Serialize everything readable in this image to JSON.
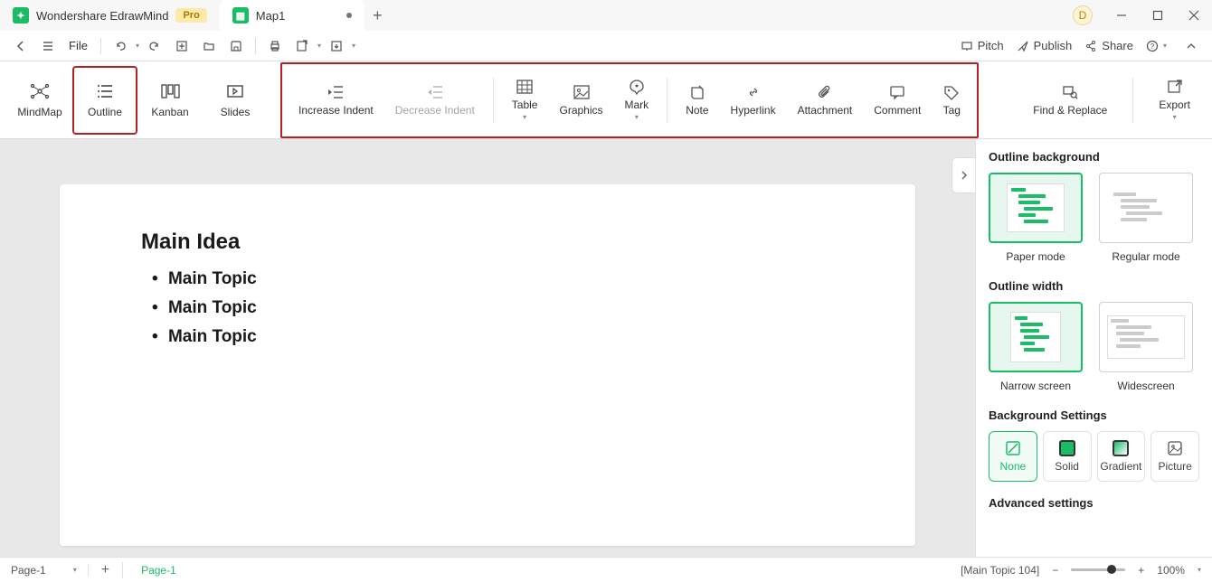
{
  "titlebar": {
    "app_name": "Wondershare EdrawMind",
    "pro_badge": "Pro",
    "doc_tab": "Map1",
    "user_initial": "D"
  },
  "toolbar": {
    "file_label": "File",
    "pitch": "Pitch",
    "publish": "Publish",
    "share": "Share"
  },
  "ribbon": {
    "views": {
      "mindmap": "MindMap",
      "outline": "Outline",
      "kanban": "Kanban",
      "slides": "Slides"
    },
    "increase_indent": "Increase Indent",
    "decrease_indent": "Decrease Indent",
    "table": "Table",
    "graphics": "Graphics",
    "mark": "Mark",
    "note": "Note",
    "hyperlink": "Hyperlink",
    "attachment": "Attachment",
    "comment": "Comment",
    "tag": "Tag",
    "find_replace": "Find & Replace",
    "export": "Export"
  },
  "document": {
    "heading": "Main Idea",
    "topics": [
      "Main Topic",
      "Main Topic",
      "Main Topic"
    ]
  },
  "right_panel": {
    "outline_background": "Outline background",
    "paper_mode": "Paper mode",
    "regular_mode": "Regular mode",
    "outline_width": "Outline width",
    "narrow_screen": "Narrow screen",
    "widescreen": "Widescreen",
    "background_settings": "Background Settings",
    "bg_none": "None",
    "bg_solid": "Solid",
    "bg_gradient": "Gradient",
    "bg_picture": "Picture",
    "advanced_settings": "Advanced settings"
  },
  "statusbar": {
    "page_dropdown": "Page-1",
    "page_tab": "Page-1",
    "status_info": "[Main Topic 104]",
    "zoom": "100%"
  }
}
